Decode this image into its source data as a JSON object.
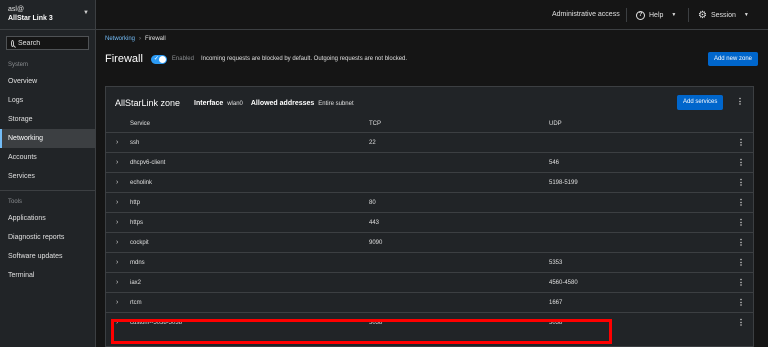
{
  "sidebar": {
    "user": "asl@",
    "host": "AllStar Link 3",
    "search_placeholder": "Search",
    "sections": {
      "system": "System",
      "tools": "Tools"
    },
    "system_items": [
      {
        "label": "Overview"
      },
      {
        "label": "Logs"
      },
      {
        "label": "Storage"
      },
      {
        "label": "Networking"
      },
      {
        "label": "Accounts"
      },
      {
        "label": "Services"
      }
    ],
    "tools_items": [
      {
        "label": "Applications"
      },
      {
        "label": "Diagnostic reports"
      },
      {
        "label": "Software updates"
      },
      {
        "label": "Terminal"
      }
    ]
  },
  "topbar": {
    "admin": "Administrative access",
    "help": "Help",
    "session": "Session"
  },
  "breadcrumb": {
    "parent": "Networking",
    "current": "Firewall"
  },
  "firewall": {
    "title": "Firewall",
    "status": "Enabled",
    "description": "Incoming requests are blocked by default. Outgoing requests are not blocked.",
    "add_zone": "Add new zone"
  },
  "zone": {
    "name": "AllStarLink zone",
    "interface_key": "Interface",
    "interface_val": "wlan0",
    "allowed_key": "Allowed addresses",
    "allowed_val": "Entire subnet",
    "add_services": "Add services",
    "columns": {
      "service": "Service",
      "tcp": "TCP",
      "udp": "UDP"
    },
    "rows": [
      {
        "service": "ssh",
        "tcp": "22",
        "udp": ""
      },
      {
        "service": "dhcpv6-client",
        "tcp": "",
        "udp": "546"
      },
      {
        "service": "echolink",
        "tcp": "",
        "udp": "5198-5199"
      },
      {
        "service": "http",
        "tcp": "80",
        "udp": ""
      },
      {
        "service": "https",
        "tcp": "443",
        "udp": ""
      },
      {
        "service": "cockpit",
        "tcp": "9090",
        "udp": ""
      },
      {
        "service": "mdns",
        "tcp": "",
        "udp": "5353"
      },
      {
        "service": "iax2",
        "tcp": "",
        "udp": "4560-4580"
      },
      {
        "service": "rtcm",
        "tcp": "",
        "udp": "1667"
      },
      {
        "service": "custom--5038-5038",
        "tcp": "5038",
        "udp": "5038"
      }
    ]
  },
  "colors": {
    "accent": "#0066cc",
    "link": "#73bcf7",
    "highlight": "#ff0000"
  }
}
